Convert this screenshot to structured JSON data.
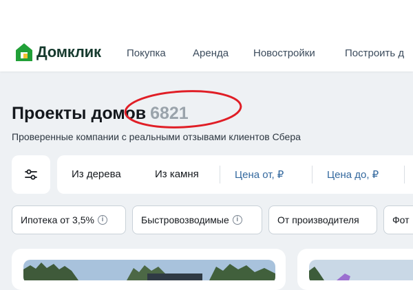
{
  "header": {
    "logo_text": "Домклик",
    "nav": [
      "Покупка",
      "Аренда",
      "Новостройки",
      "Построить д"
    ]
  },
  "title": {
    "text": "Проекты домов",
    "count": "6821",
    "annotation_color": "#e01e26"
  },
  "subtitle": "Проверенные компании с реальными отзывами клиентов Сбера",
  "filters": {
    "icon": "sliders-icon",
    "material_wood": "Из дерева",
    "material_stone": "Из камня",
    "price_from": "Цена от, ₽",
    "price_to": "Цена до, ₽"
  },
  "chips": [
    "Ипотека от 3,5%",
    "Быстровозводимые",
    "От производителя",
    "Фот"
  ],
  "chip_info_icon": "info-icon",
  "colors": {
    "brand_green": "#21a038",
    "brand_yellow": "#f2c230",
    "price_link": "#33689e"
  }
}
